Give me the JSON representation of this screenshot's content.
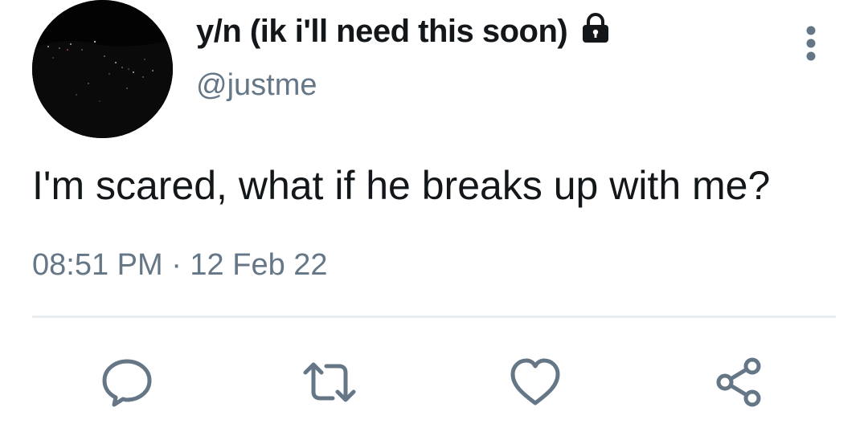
{
  "tweet": {
    "display_name": "y/n (ik i'll need this soon)",
    "handle": "@justme",
    "text": "I'm scared, what if he breaks up with me?",
    "time": "08:51 PM",
    "separator": "·",
    "date": "12 Feb 22",
    "timestamp_display": "08:51 PM · 12 Feb 22"
  },
  "icons": {
    "lock": "lock-icon",
    "more": "more-vertical-icon",
    "reply": "reply-icon",
    "retweet": "retweet-icon",
    "like": "heart-icon",
    "share": "share-icon"
  },
  "colors": {
    "text_primary": "#14171a",
    "text_secondary": "#657786",
    "divider": "#e6ecf0",
    "icon": "#657786"
  }
}
